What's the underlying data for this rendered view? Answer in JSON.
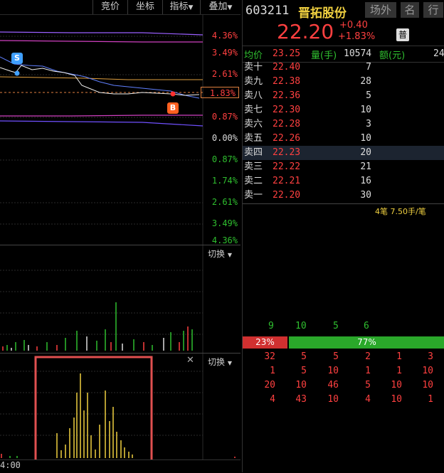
{
  "toolbar": {
    "auction": "竞价",
    "coord": "坐标",
    "indicator": "指标",
    "overlay": "叠加"
  },
  "price_axis": {
    "up": [
      "4.36%",
      "3.49%",
      "2.61%",
      "1.83%",
      "0.87%"
    ],
    "zero": "0.00%",
    "down": [
      "0.87%",
      "1.74%",
      "2.61%",
      "3.49%",
      "4.36%"
    ]
  },
  "markers": {
    "sell": "S",
    "buy": "B"
  },
  "switch_label": "切换",
  "switch_arrow": "▼",
  "close_icon": "✕",
  "time_label": "4:00",
  "stock": {
    "code": "603211",
    "name": "晋拓股份",
    "tab1": "场外",
    "tab2": "名",
    "tab3": "行",
    "price": "22.20",
    "change": "+0.40",
    "change_pct": "+1.83%",
    "badge": "普"
  },
  "stats": {
    "avg_label": "均价",
    "avg": "23.25",
    "vol_label": "量(手)",
    "vol": "10574",
    "amt_label": "额(元)",
    "amt": "24"
  },
  "order_book": [
    {
      "label": "卖十",
      "price": "22.40",
      "vol": "7"
    },
    {
      "label": "卖九",
      "price": "22.38",
      "vol": "28"
    },
    {
      "label": "卖八",
      "price": "22.36",
      "vol": "5"
    },
    {
      "label": "卖七",
      "price": "22.30",
      "vol": "10"
    },
    {
      "label": "卖六",
      "price": "22.28",
      "vol": "3"
    },
    {
      "label": "卖五",
      "price": "22.26",
      "vol": "10"
    },
    {
      "label": "卖四",
      "price": "22.23",
      "vol": "20"
    },
    {
      "label": "卖三",
      "price": "22.22",
      "vol": "21"
    },
    {
      "label": "卖二",
      "price": "22.21",
      "vol": "16"
    },
    {
      "label": "卖一",
      "price": "22.20",
      "vol": "30"
    }
  ],
  "trade_note": "4笔 7.50手/笔",
  "big_order_counts": [
    "9",
    "10",
    "5",
    "6"
  ],
  "ratio": {
    "sell_pct": "23%",
    "buy_pct": "77%",
    "sell_value": 0.23,
    "buy_value": 0.77
  },
  "detail_grid": [
    [
      "32",
      "5",
      "5",
      "2",
      "1",
      "3"
    ],
    [
      "1",
      "5",
      "10",
      "1",
      "1",
      "10"
    ],
    [
      "20",
      "10",
      "46",
      "5",
      "10",
      "10"
    ],
    [
      "4",
      "43",
      "10",
      "4",
      "10",
      "1"
    ]
  ],
  "colors": {
    "up": "#ff4040",
    "down": "#2fbf2f",
    "gold": "#f0d040",
    "highlight_box": "#e05050"
  }
}
